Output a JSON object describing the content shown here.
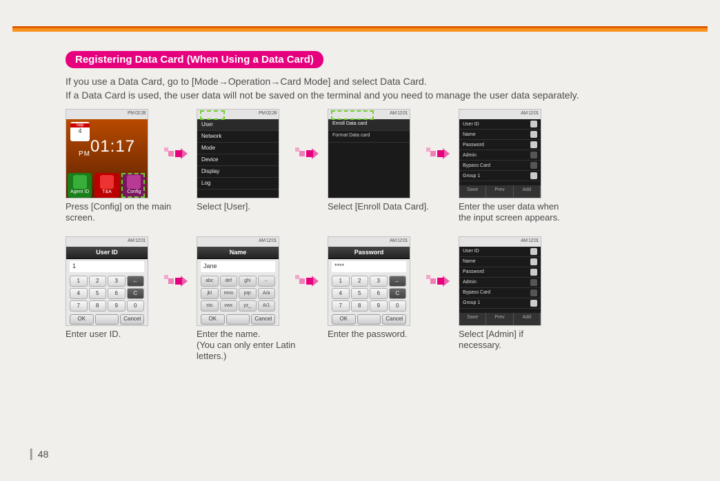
{
  "header": {
    "title": "Registering Data Card (When Using a Data Card)",
    "intro_line1": "If you use a Data Card, go to [Mode→Operation→Card Mode] and select Data Card.",
    "intro_line2": "If a Data Card is used, the user data will not be saved on the terminal and you need to manage the user data separately."
  },
  "status_right": "PM 02:28",
  "status_am": "AM 12:01",
  "steps": {
    "s1": {
      "caption": "Press [Config] on the main screen.",
      "clock": "01:17",
      "date_month": "Sep",
      "date_day": "4",
      "icons": {
        "a": "Agent ID",
        "b": "T&A",
        "c": "Config"
      }
    },
    "s2": {
      "caption": "Select [User].",
      "items": [
        "User",
        "Network",
        "Mode",
        "Device",
        "Display",
        "Log"
      ]
    },
    "s3": {
      "caption": "Select [Enroll Data Card].",
      "items": [
        "Enroll Data card",
        "Format Data card"
      ]
    },
    "s4": {
      "caption": "Enter the user data when the input screen appears.",
      "fields": [
        "User ID",
        "Name",
        "Password",
        "Admin",
        "Bypass Card",
        "Group  1"
      ]
    },
    "s5": {
      "caption": "Enter user ID.",
      "title": "User ID",
      "value": "1",
      "keys": [
        "1",
        "2",
        "3",
        "←",
        "4",
        "5",
        "6",
        "C",
        "7",
        "8",
        "9",
        "0"
      ],
      "btns": [
        "OK",
        "",
        "Cancel"
      ]
    },
    "s6": {
      "caption": "Enter the name.\n(You can only enter Latin letters.)",
      "title": "Name",
      "value": "Jane",
      "keys": [
        "abc",
        "def",
        "ghi",
        "←",
        "jkl",
        "mno",
        "pqr",
        "A/a",
        "stu",
        "vwx",
        "yz_",
        "A/1"
      ],
      "btns": [
        "OK",
        "",
        "Cancel"
      ]
    },
    "s7": {
      "caption": "Enter the password.",
      "title": "Password",
      "value": "****",
      "keys": [
        "1",
        "2",
        "3",
        "←",
        "4",
        "5",
        "6",
        "C",
        "7",
        "8",
        "9",
        "0"
      ],
      "btns": [
        "OK",
        "",
        "Cancel"
      ]
    },
    "s8": {
      "caption": "Select [Admin] if necessary.",
      "fields": [
        "User ID",
        "Name",
        "Password",
        "Admin",
        "Bypass Card",
        "Group  1"
      ]
    }
  },
  "bottombar": [
    "Save",
    "Prev",
    "Add"
  ],
  "page": "48"
}
